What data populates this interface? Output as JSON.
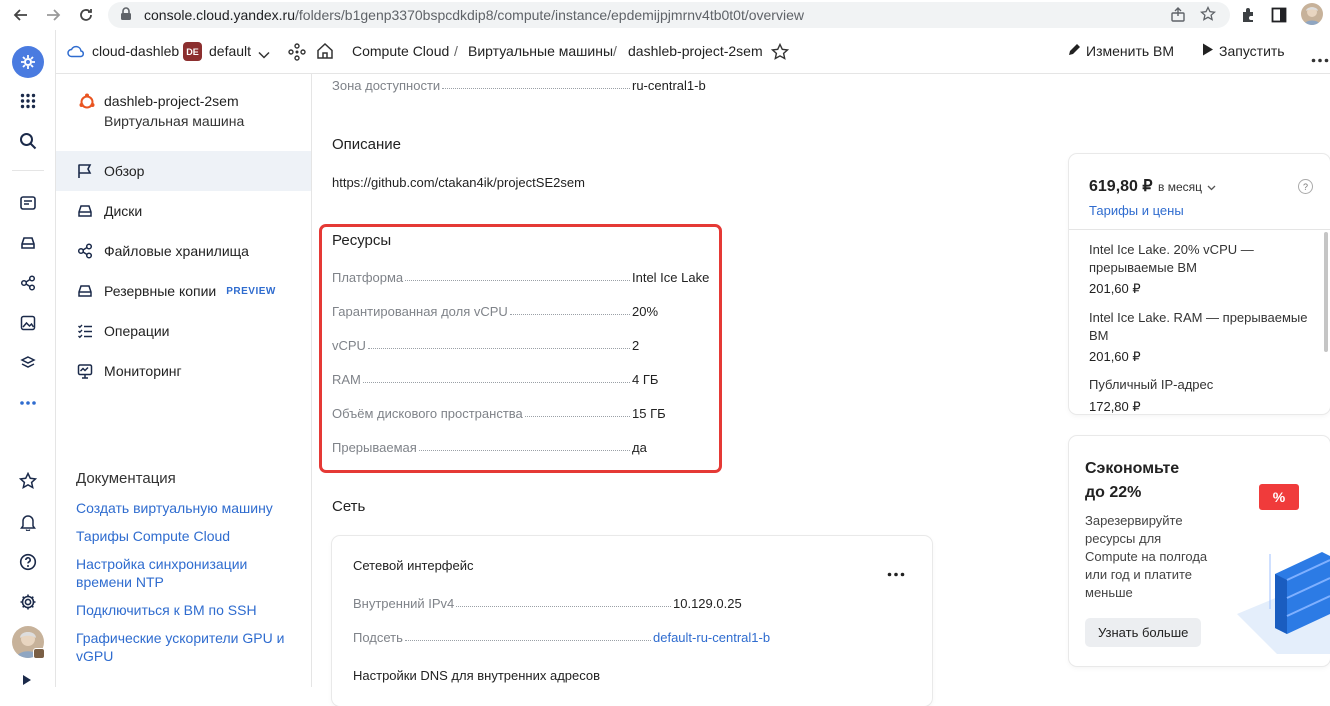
{
  "browser": {
    "url_domain": "console.cloud.yandex.ru",
    "url_path": "/folders/b1genp3370bspcdkdip8/compute/instance/epdemijpjmrnv4tb0t0t/overview"
  },
  "topnav": {
    "cloud": "cloud-dashleb",
    "folder_badge": "DE",
    "folder": "default",
    "breadcrumb": [
      "Compute Cloud",
      "Виртуальные машины",
      "dashleb-project-2sem"
    ],
    "separator": "/",
    "edit_button": "Изменить ВМ",
    "start_button": "Запустить"
  },
  "sidebar": {
    "vm_name": "dashleb-project-2sem",
    "vm_type": "Виртуальная машина",
    "items": [
      {
        "label": "Обзор",
        "icon": "flag-icon"
      },
      {
        "label": "Диски",
        "icon": "disk-icon"
      },
      {
        "label": "Файловые хранилища",
        "icon": "storage-icon"
      },
      {
        "label": "Резервные копии",
        "icon": "backup-icon",
        "badge": "PREVIEW"
      },
      {
        "label": "Операции",
        "icon": "operations-icon"
      },
      {
        "label": "Мониторинг",
        "icon": "monitor-icon"
      }
    ],
    "docs_title": "Документация",
    "docs": [
      "Создать виртуальную машину",
      "Тарифы Compute Cloud",
      "Настройка синхронизации времени NTP",
      "Подключиться к ВМ по SSH",
      "Графические ускорители GPU и vGPU"
    ]
  },
  "main": {
    "zone": {
      "key": "Зона доступности",
      "value": "ru-central1-b"
    },
    "description_title": "Описание",
    "description": "https://github.com/ctakan4ik/projectSE2sem",
    "resources_title": "Ресурсы",
    "resources": [
      {
        "key": "Платформа",
        "value": "Intel Ice Lake"
      },
      {
        "key": "Гарантированная доля vCPU",
        "value": "20%"
      },
      {
        "key": "vCPU",
        "value": "2"
      },
      {
        "key": "RAM",
        "value": "4 ГБ"
      },
      {
        "key": "Объём дискового пространства",
        "value": "15 ГБ"
      },
      {
        "key": "Прерываемая",
        "value": "да"
      }
    ],
    "network_title": "Сеть",
    "network_card": {
      "title": "Сетевой интерфейс",
      "rows": [
        {
          "key": "Внутренний IPv4",
          "value": "10.129.0.25"
        },
        {
          "key": "Подсеть",
          "value": "default-ru-central1-b"
        }
      ],
      "dns_title": "Настройки DNS для внутренних адресов"
    }
  },
  "pricing": {
    "total": "619,80 ₽",
    "period": "в месяц",
    "link": "Тарифы и цены",
    "help": "?",
    "items": [
      {
        "name": "Intel Ice Lake. 20% vCPU — прерываемые ВМ",
        "price": "201,60 ₽"
      },
      {
        "name": "Intel Ice Lake. RAM — прерываемые ВМ",
        "price": "201,60 ₽"
      },
      {
        "name": "Публичный IP-адрес",
        "price": "172,80 ₽"
      }
    ]
  },
  "promo": {
    "title_line1": "Сэкономьте",
    "title_line2": "до 22%",
    "text": "Зарезервируйте ресурсы для Compute на полгода или год и платите меньше",
    "button": "Узнать больше",
    "badge": "%"
  },
  "colors": {
    "accent": "#2f6ccf",
    "highlight_border": "#e53935",
    "rail_active": "#4a7be0"
  }
}
